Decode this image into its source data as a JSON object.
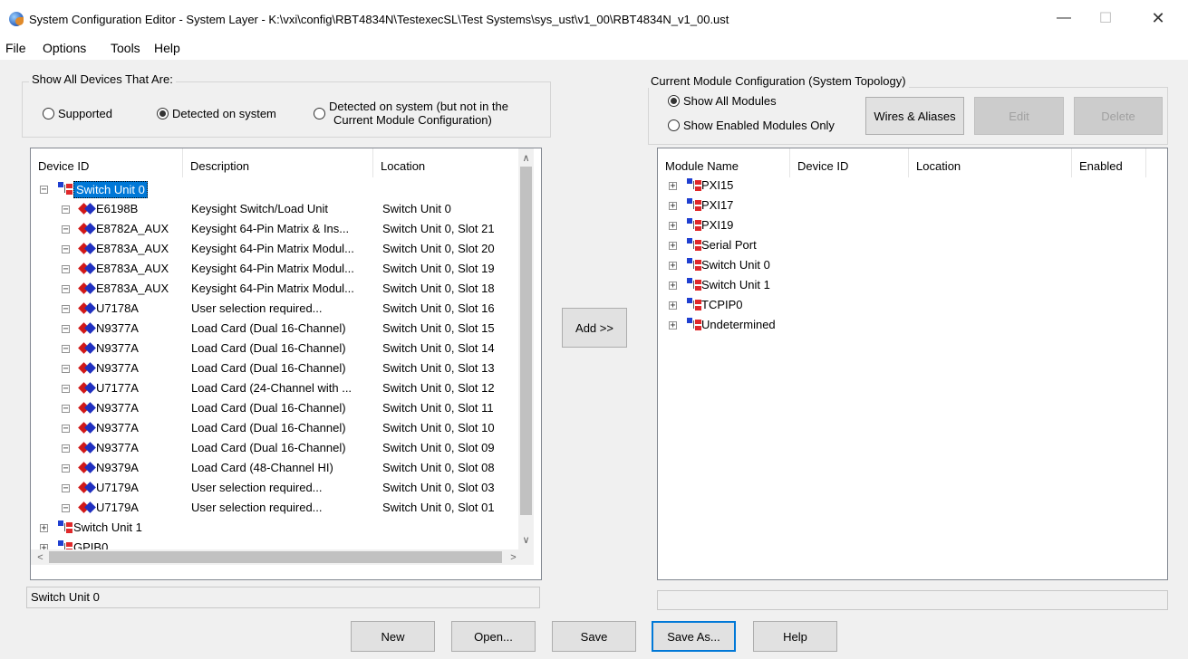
{
  "window": {
    "title": "System Configuration Editor - System Layer - K:\\vxi\\config\\RBT4834N\\TestexecSL\\Test Systems\\sys_ust\\v1_00\\RBT4834N_v1_00.ust",
    "minimize": "—",
    "maximize": "☐",
    "close": "✕"
  },
  "menu": [
    "File",
    "Options",
    "Tools",
    "Help"
  ],
  "left": {
    "group_title": "Show All Devices That Are:",
    "radio_supported": "Supported",
    "radio_detected": "Detected on system",
    "radio_not_in_config_1": "Detected on system  (but not in the",
    "radio_not_in_config_2": "Current Module Configuration)",
    "columns": [
      "Device ID",
      "Description",
      "Location"
    ],
    "tree": [
      {
        "id": "Switch Unit 0",
        "desc": "",
        "loc": "",
        "level": 0,
        "kind": "net",
        "exp": "−",
        "selected": true
      },
      {
        "id": "E6198B",
        "desc": "Keysight Switch/Load Unit",
        "loc": "Switch Unit 0",
        "level": 1,
        "kind": "card",
        "exp": "−"
      },
      {
        "id": "E8782A_AUX",
        "desc": "Keysight 64-Pin Matrix & Ins...",
        "loc": "Switch Unit 0, Slot 21",
        "level": 1,
        "kind": "card",
        "exp": "−"
      },
      {
        "id": "E8783A_AUX",
        "desc": "Keysight 64-Pin Matrix Modul...",
        "loc": "Switch Unit 0, Slot 20",
        "level": 1,
        "kind": "card",
        "exp": "−"
      },
      {
        "id": "E8783A_AUX",
        "desc": "Keysight 64-Pin Matrix Modul...",
        "loc": "Switch Unit 0, Slot 19",
        "level": 1,
        "kind": "card",
        "exp": "−"
      },
      {
        "id": "E8783A_AUX",
        "desc": "Keysight 64-Pin Matrix Modul...",
        "loc": "Switch Unit 0, Slot 18",
        "level": 1,
        "kind": "card",
        "exp": "−"
      },
      {
        "id": "U7178A",
        "desc": "User selection required...",
        "loc": "Switch Unit 0, Slot 16",
        "level": 1,
        "kind": "card",
        "exp": "−"
      },
      {
        "id": "N9377A",
        "desc": "Load Card (Dual 16-Channel)",
        "loc": "Switch Unit 0, Slot 15",
        "level": 1,
        "kind": "card",
        "exp": "−"
      },
      {
        "id": "N9377A",
        "desc": "Load Card (Dual 16-Channel)",
        "loc": "Switch Unit 0, Slot 14",
        "level": 1,
        "kind": "card",
        "exp": "−"
      },
      {
        "id": "N9377A",
        "desc": "Load Card (Dual 16-Channel)",
        "loc": "Switch Unit 0, Slot 13",
        "level": 1,
        "kind": "card",
        "exp": "−"
      },
      {
        "id": "U7177A",
        "desc": "Load Card (24-Channel with ...",
        "loc": "Switch Unit 0, Slot 12",
        "level": 1,
        "kind": "card",
        "exp": "−"
      },
      {
        "id": "N9377A",
        "desc": "Load Card (Dual 16-Channel)",
        "loc": "Switch Unit 0, Slot 11",
        "level": 1,
        "kind": "card",
        "exp": "−"
      },
      {
        "id": "N9377A",
        "desc": "Load Card (Dual 16-Channel)",
        "loc": "Switch Unit 0, Slot 10",
        "level": 1,
        "kind": "card",
        "exp": "−"
      },
      {
        "id": "N9377A",
        "desc": "Load Card (Dual 16-Channel)",
        "loc": "Switch Unit 0, Slot 09",
        "level": 1,
        "kind": "card",
        "exp": "−"
      },
      {
        "id": "N9379A",
        "desc": "Load Card (48-Channel HI)",
        "loc": "Switch Unit 0, Slot 08",
        "level": 1,
        "kind": "card",
        "exp": "−"
      },
      {
        "id": "U7179A",
        "desc": "User selection required...",
        "loc": "Switch Unit 0, Slot 03",
        "level": 1,
        "kind": "card",
        "exp": "−"
      },
      {
        "id": "U7179A",
        "desc": "User selection required...",
        "loc": "Switch Unit 0, Slot 01",
        "level": 1,
        "kind": "card",
        "exp": "−"
      },
      {
        "id": "Switch Unit 1",
        "desc": "",
        "loc": "",
        "level": 0,
        "kind": "net",
        "exp": "+"
      },
      {
        "id": "GPIB0",
        "desc": "",
        "loc": "",
        "level": 0,
        "kind": "net",
        "exp": "+"
      }
    ],
    "status": "Switch Unit 0"
  },
  "add_button": "Add >>",
  "right": {
    "group_title": "Current Module Configuration (System Topology)",
    "radio_all": "Show All Modules",
    "radio_enabled": "Show Enabled Modules Only",
    "btn_wires": "Wires & Aliases",
    "btn_edit": "Edit",
    "btn_delete": "Delete",
    "columns": [
      "Module Name",
      "Device ID",
      "Location",
      "Enabled"
    ],
    "tree": [
      {
        "name": "PXI15",
        "exp": "+"
      },
      {
        "name": "PXI17",
        "exp": "+"
      },
      {
        "name": "PXI19",
        "exp": "+"
      },
      {
        "name": "Serial Port",
        "exp": "+"
      },
      {
        "name": "Switch Unit 0",
        "exp": "+"
      },
      {
        "name": "Switch Unit 1",
        "exp": "+"
      },
      {
        "name": "TCPIP0",
        "exp": "+"
      },
      {
        "name": "Undetermined",
        "exp": "+"
      }
    ]
  },
  "bottom_buttons": {
    "new": "New",
    "open": "Open...",
    "save": "Save",
    "save_as": "Save As...",
    "help": "Help"
  },
  "scroll_arrows": {
    "up": "∧",
    "down": "∨",
    "left": "<",
    "right": ">"
  }
}
